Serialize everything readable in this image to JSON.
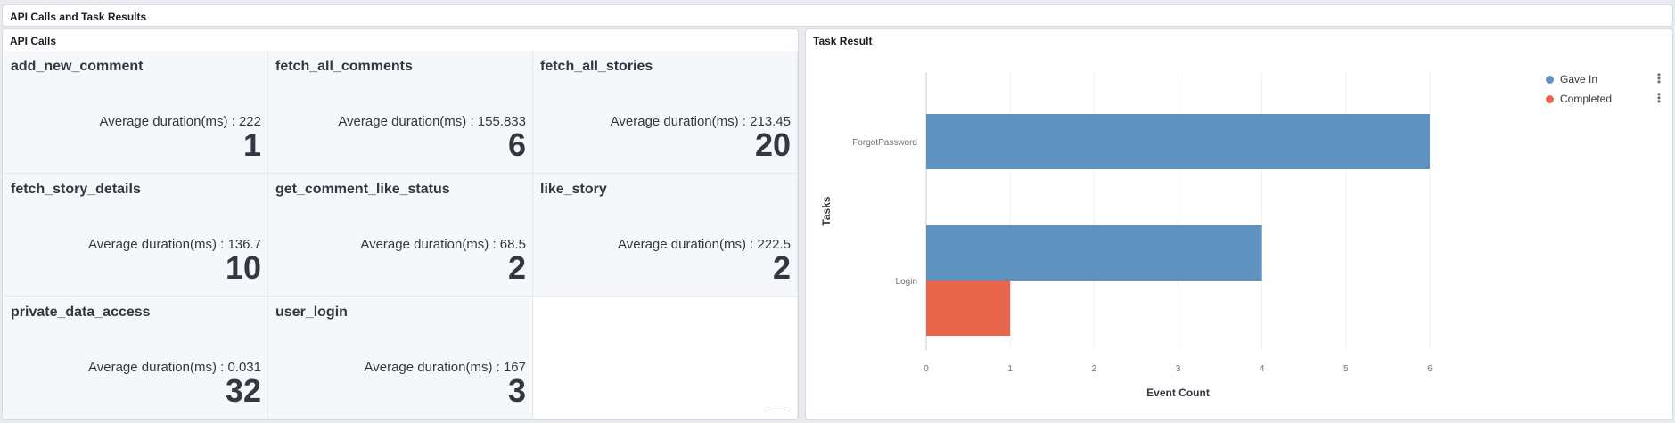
{
  "header": {
    "title": "API Calls and Task Results"
  },
  "api_panel": {
    "title": "API Calls",
    "tiles": [
      {
        "name": "add_new_comment",
        "avg": "Average duration(ms) : 222",
        "count": "1"
      },
      {
        "name": "fetch_all_comments",
        "avg": "Average duration(ms) : 155.833",
        "count": "6"
      },
      {
        "name": "fetch_all_stories",
        "avg": "Average duration(ms) : 213.45",
        "count": "20"
      },
      {
        "name": "fetch_story_details",
        "avg": "Average duration(ms) : 136.7",
        "count": "10"
      },
      {
        "name": "get_comment_like_status",
        "avg": "Average duration(ms) : 68.5",
        "count": "2"
      },
      {
        "name": "like_story",
        "avg": "Average duration(ms) : 222.5",
        "count": "2"
      },
      {
        "name": "private_data_access",
        "avg": "Average duration(ms) : 0.031",
        "count": "32"
      },
      {
        "name": "user_login",
        "avg": "Average duration(ms) : 167",
        "count": "3"
      }
    ]
  },
  "task_panel": {
    "title": "Task Result"
  },
  "chart_data": {
    "type": "bar",
    "orientation": "horizontal",
    "categories": [
      "ForgotPassword",
      "Login"
    ],
    "series": [
      {
        "name": "Gave In",
        "color": "#6092c0",
        "values": [
          6,
          4
        ]
      },
      {
        "name": "Completed",
        "color": "#e7664c",
        "values": [
          0,
          1
        ]
      }
    ],
    "xlabel": "Event Count",
    "ylabel": "Tasks",
    "xlim": [
      0,
      6
    ],
    "xticks": [
      "0",
      "1",
      "2",
      "3",
      "4",
      "5",
      "6"
    ],
    "grid": true,
    "legend": "top-right"
  }
}
